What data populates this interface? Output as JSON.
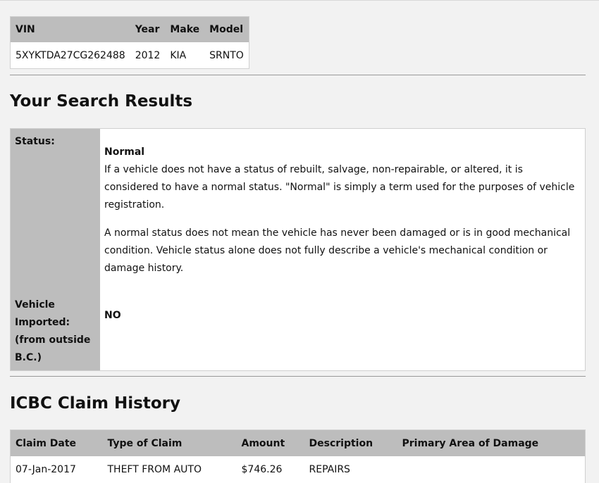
{
  "vehicle": {
    "headers": [
      "VIN",
      "Year",
      "Make",
      "Model"
    ],
    "row": [
      "5XYKTDA27CG262488",
      "2012",
      "KIA",
      "SRNTO"
    ]
  },
  "results": {
    "heading": "Your Search Results",
    "status_label": "Status:",
    "status_value": "Normal",
    "status_paragraph1": "If a vehicle does not have a status of rebuilt, salvage, non-repairable, or altered, it is considered to have a normal status. \"Normal\" is simply a term used for the purposes of vehicle registration.",
    "status_paragraph2": "A normal status does not mean the vehicle has never been damaged or is in good mechanical condition. Vehicle status alone does not fully describe a vehicle's mechanical condition or damage history.",
    "imported_label_line1": "Vehicle Imported:",
    "imported_label_line2": "(from outside B.C.)",
    "imported_value": "NO"
  },
  "claims": {
    "heading": "ICBC Claim History",
    "headers": [
      "Claim Date",
      "Type of Claim",
      "Amount",
      "Description",
      "Primary Area of Damage"
    ],
    "rows": [
      [
        "07-Jan-2017",
        "THEFT FROM AUTO",
        "$746.26",
        "REPAIRS",
        ""
      ]
    ]
  }
}
